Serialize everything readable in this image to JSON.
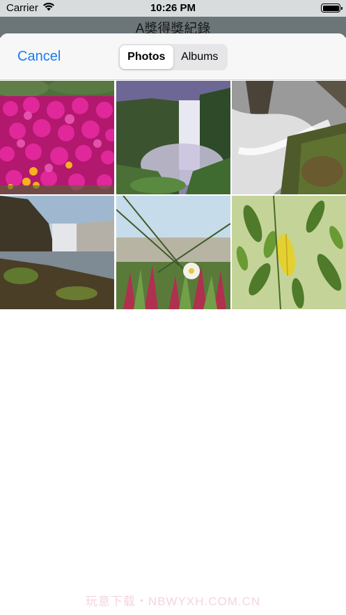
{
  "status_bar": {
    "carrier": "Carrier",
    "time": "10:26 PM"
  },
  "underlying_title": "A獎得獎紀錄",
  "picker": {
    "cancel_label": "Cancel",
    "segments": [
      {
        "label": "Photos",
        "selected": true
      },
      {
        "label": "Albums",
        "selected": false
      }
    ]
  },
  "photos": [
    {
      "name": "pink-flowers",
      "description": "pink and yellow flowers"
    },
    {
      "name": "misty-waterfall",
      "description": "misty waterfall"
    },
    {
      "name": "waterfall-rocks",
      "description": "waterfall over mossy rocks"
    },
    {
      "name": "waterfall-shore",
      "description": "waterfall with rocky shore"
    },
    {
      "name": "beach-flower",
      "description": "white flower on dunes"
    },
    {
      "name": "green-leaves",
      "description": "green and yellow leaves"
    }
  ],
  "watermark": "玩意下载・NBWYXH.COM.CN",
  "colors": {
    "accent": "#1a7cf0",
    "status_bar": "#d8dcdc"
  }
}
